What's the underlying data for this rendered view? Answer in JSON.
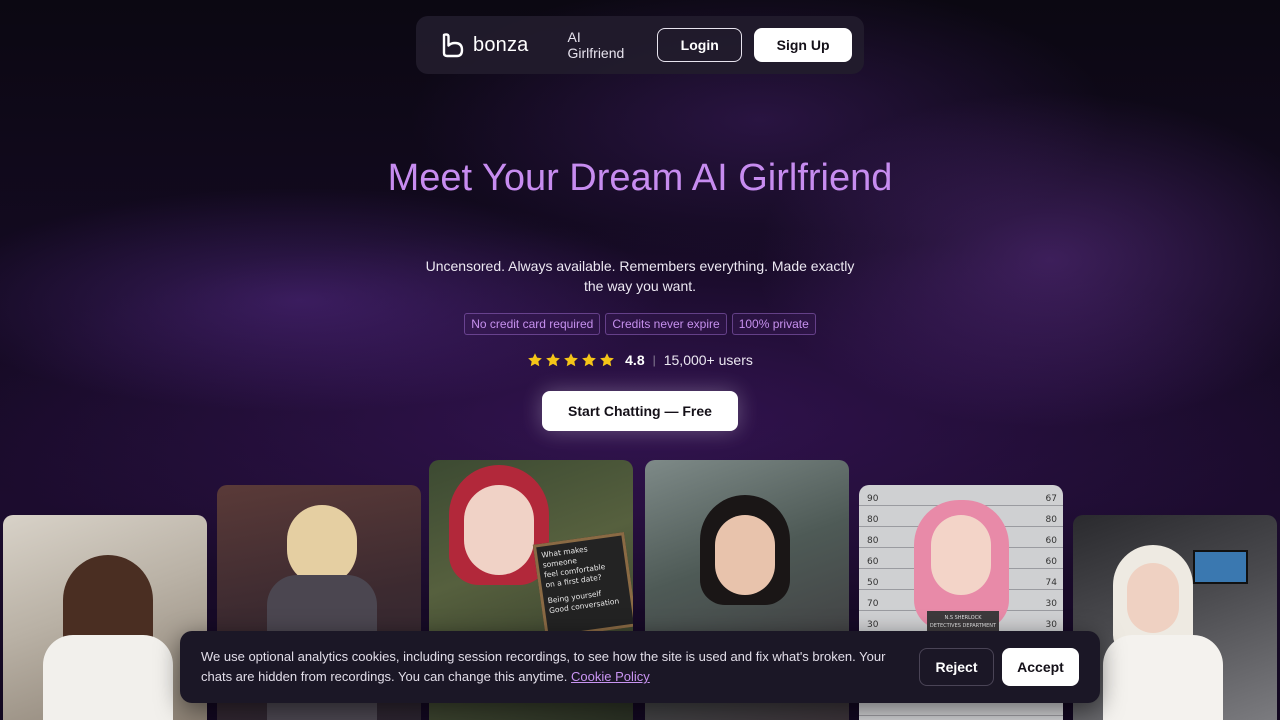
{
  "nav": {
    "brand": "bonza",
    "link": "AI Girlfriend",
    "login_label": "Login",
    "signup_label": "Sign Up"
  },
  "hero": {
    "title": "Meet Your Dream AI Girlfriend",
    "subtitle": "Uncensored. Always available. Remembers everything. Made exactly the way you want.",
    "badges": [
      "No credit card required",
      "Credits never expire",
      "100% private"
    ],
    "rating_value": "4.8",
    "stars": 5,
    "separator": "|",
    "users": "15,000+ users",
    "cta_label": "Start Chatting — Free"
  },
  "cards": {
    "chalkboard_line1": "What makes someone",
    "chalkboard_line2": "feel comfortable",
    "chalkboard_line3": "on a first date?",
    "chalkboard_item1": "Being yourself",
    "chalkboard_item2": "Good conversation",
    "mugshot_left": [
      "90",
      "80",
      "80",
      "60",
      "50",
      "70",
      "30"
    ],
    "mugshot_right": [
      "67",
      "80",
      "60",
      "60",
      "74",
      "30",
      "30"
    ],
    "mugshot_sign1": "N.S SHERLOCK",
    "mugshot_sign2": "DETECTIVES DEPARTMENT"
  },
  "cookie": {
    "text": "We use optional analytics cookies, including session recordings, to see how the site is used and fix what's broken. Your chats are hidden from recordings. You can change this anytime.",
    "link_label": "Cookie Policy",
    "reject_label": "Reject",
    "accept_label": "Accept"
  },
  "colors": {
    "accent": "#c78cf0",
    "star": "#f5c518"
  }
}
